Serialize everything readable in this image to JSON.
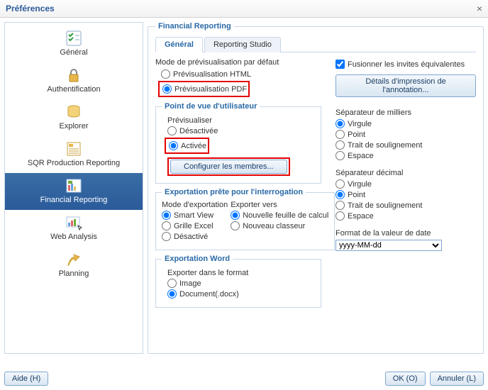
{
  "window": {
    "title": "Préférences",
    "close": "×"
  },
  "sidebar": {
    "items": [
      {
        "label": "Général"
      },
      {
        "label": "Authentification"
      },
      {
        "label": "Explorer"
      },
      {
        "label": "SQR Production Reporting"
      },
      {
        "label": "Financial Reporting"
      },
      {
        "label": "Web Analysis"
      },
      {
        "label": "Planning"
      }
    ]
  },
  "content": {
    "section_title": "Financial Reporting",
    "tabs": {
      "general": "Général",
      "studio": "Reporting Studio"
    },
    "preview_mode": {
      "title": "Mode de prévisualisation par défaut",
      "html": "Prévisualisation HTML",
      "pdf": "Prévisualisation PDF"
    },
    "pov": {
      "title": "Point de vue d'utilisateur",
      "preview_label": "Prévisualiser",
      "off": "Désactivée",
      "on": "Activée",
      "config_btn": "Configurer les membres..."
    },
    "export_query": {
      "title": "Exportation prête pour l'interrogation",
      "mode_label": "Mode d'exportation",
      "target_label": "Exporter vers",
      "modes": {
        "smartview": "Smart View",
        "grid": "Grille Excel",
        "off": "Désactivé"
      },
      "targets": {
        "newsheet": "Nouvelle feuille de calcul",
        "newbook": "Nouveau classeur"
      }
    },
    "export_word": {
      "title": "Exportation Word",
      "label": "Exporter dans le format",
      "image": "Image",
      "docx": "Document(.docx)"
    },
    "merge": {
      "label": "Fusionner les invites équivalentes"
    },
    "annot_btn": "Détails d'impression de l'annotation...",
    "thousands": {
      "title": "Séparateur de milliers",
      "comma": "Virgule",
      "dot": "Point",
      "under": "Trait de soulignement",
      "space": "Espace"
    },
    "decimal": {
      "title": "Séparateur décimal",
      "comma": "Virgule",
      "dot": "Point",
      "under": "Trait de soulignement",
      "space": "Espace"
    },
    "datefmt": {
      "title": "Format de la valeur de date",
      "value": "yyyy-MM-dd"
    }
  },
  "buttons": {
    "help": "Aide (H)",
    "ok": "OK (O)",
    "cancel": "Annuler (L)"
  }
}
